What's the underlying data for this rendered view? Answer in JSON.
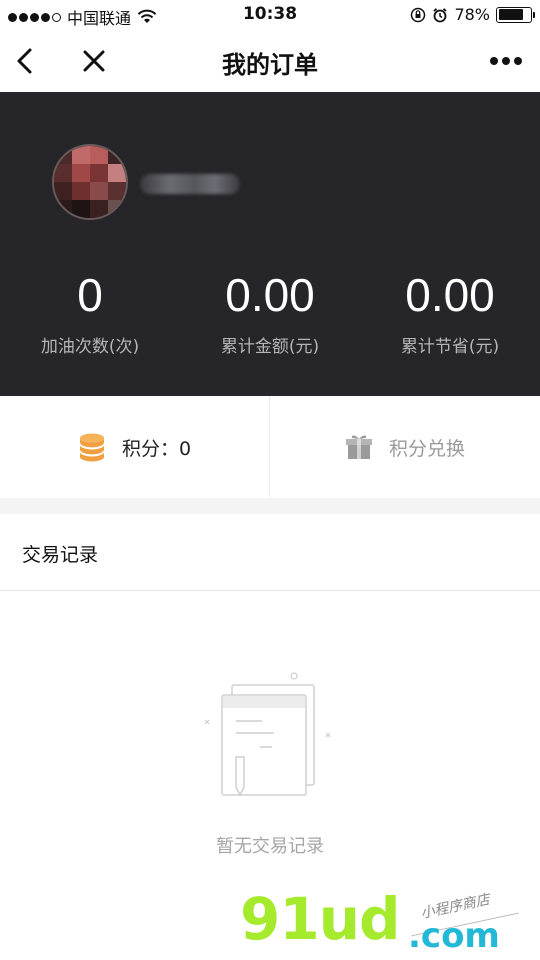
{
  "status_bar": {
    "carrier": "中国联通",
    "time": "10:38",
    "battery_percent": "78%",
    "battery_level": 0.78,
    "signal_dots": [
      true,
      true,
      true,
      true,
      false
    ],
    "icons": [
      "signal-dots-icon",
      "wifi-icon",
      "rotation-lock-icon",
      "alarm-icon",
      "battery-icon"
    ]
  },
  "nav": {
    "title": "我的订单",
    "icons": [
      "back-arrow-icon",
      "close-icon",
      "more-dots-icon"
    ]
  },
  "profile": {
    "stats": [
      {
        "value": "0",
        "label": "加油次数(次)"
      },
      {
        "value": "0.00",
        "label": "累计金额(元)"
      },
      {
        "value": "0.00",
        "label": "累计节省(元)"
      }
    ]
  },
  "points": {
    "label": "积分：",
    "value": "0",
    "exchange_label": "积分兑换",
    "icons": [
      "coin-stack-icon",
      "gift-box-icon"
    ]
  },
  "transactions": {
    "title": "交易记录",
    "empty_text": "暂无交易记录",
    "empty_icon": "empty-document-icon"
  },
  "watermark": {
    "main": "91ud",
    "domain": ".com",
    "tag": "小程序商店"
  },
  "colors": {
    "header_dark": "#25252a",
    "stat_label": "#b5b5b8",
    "coin": "#f0a040",
    "watermark_green": "#a6ea2e",
    "watermark_blue": "#22b8d6"
  }
}
